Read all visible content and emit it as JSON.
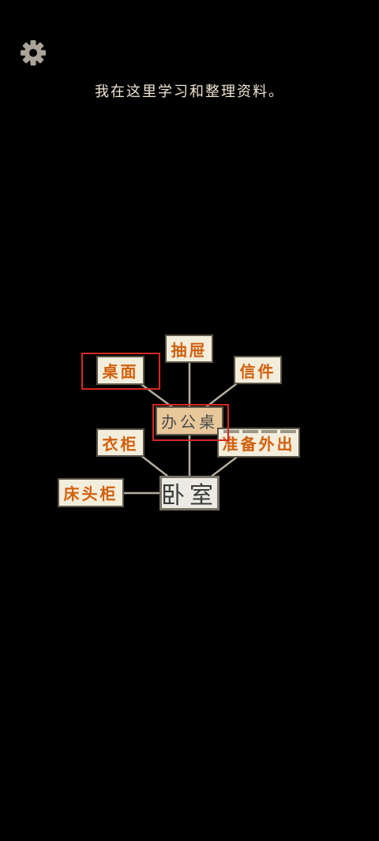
{
  "header": {
    "settings_icon": "gear-icon",
    "caption": "我在这里学习和整理资料。"
  },
  "map": {
    "center": {
      "label": "办公桌"
    },
    "room": {
      "label": "卧室"
    },
    "nodes": {
      "drawer": "抽屉",
      "desktop": "桌面",
      "letter": "信件",
      "wardrobe": "衣柜",
      "prepare_go_out": "准备外出",
      "bedside_cabinet": "床头柜"
    },
    "highlighted": [
      "desktop",
      "center"
    ]
  },
  "colors": {
    "background": "#000000",
    "node_bg": "#f3eddc",
    "node_text": "#d2600c",
    "center_bg": "#e8c89a",
    "highlight": "#d42a1e",
    "line": "#b3ae9f"
  }
}
